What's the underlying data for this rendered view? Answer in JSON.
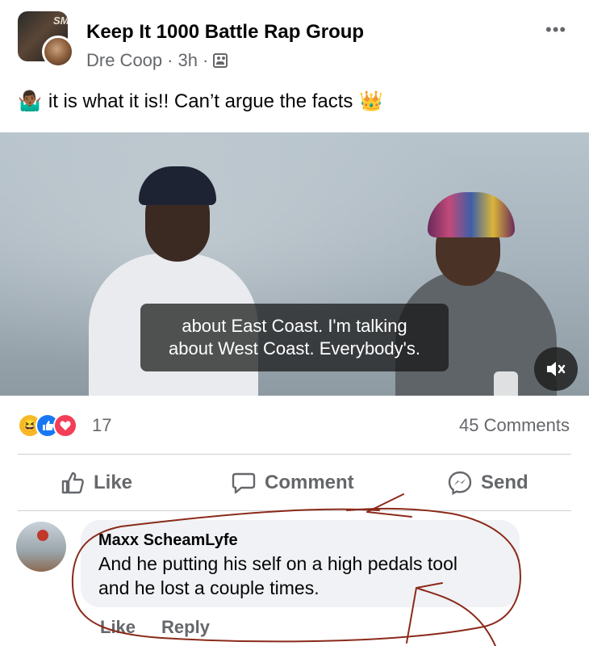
{
  "post": {
    "group_name": "Keep It 1000 Battle Rap Group",
    "author": "Dre Coop",
    "time": "3h",
    "separator": "·",
    "avatar_badge": "SM",
    "text": "it is what it is!! Can’t argue the facts",
    "leading_emoji": "🤷🏾‍♂️",
    "trailing_emoji": "👑"
  },
  "video": {
    "caption_line1": "about East Coast. I'm talking",
    "caption_line2": "about West Coast. Everybody's.",
    "mute_icon": "speaker-muted-icon"
  },
  "stats": {
    "reaction_count": "17",
    "comments": "45 Comments",
    "reaction_icons": [
      "haha-icon",
      "like-icon",
      "love-icon"
    ]
  },
  "actions": {
    "like": "Like",
    "comment": "Comment",
    "send": "Send"
  },
  "comment": {
    "name": "Maxx ScheamLyfe",
    "line1": "And he putting his self on a high pedals tool",
    "line2": "and he lost a couple times.",
    "like": "Like",
    "reply": "Reply"
  },
  "colors": {
    "secondary_text": "#65676b",
    "bubble": "#f0f2f5",
    "annotation": "#8b2a1a"
  }
}
